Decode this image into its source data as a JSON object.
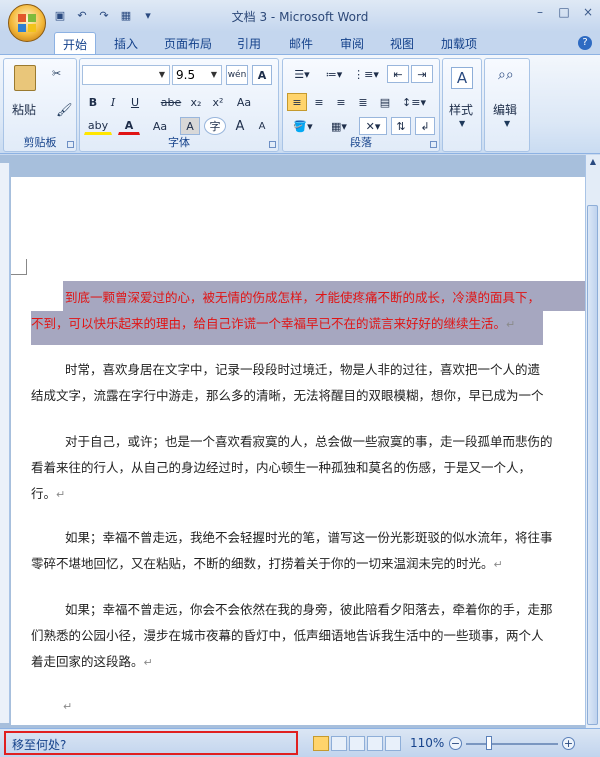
{
  "window": {
    "title": "文档 3 - Microsoft Word",
    "controls": {
      "minimize": "–",
      "maximize": "□",
      "close": "×"
    }
  },
  "quick_access": {
    "save_icon": "save-icon",
    "undo_icon": "undo-icon",
    "redo_icon": "redo-icon",
    "table_icon": "table-icon",
    "more_icon": "chevron-down-icon"
  },
  "tabs": [
    {
      "label": "开始",
      "active": true
    },
    {
      "label": "插入"
    },
    {
      "label": "页面布局"
    },
    {
      "label": "引用"
    },
    {
      "label": "邮件"
    },
    {
      "label": "审阅"
    },
    {
      "label": "视图"
    },
    {
      "label": "加载项"
    }
  ],
  "help": "?",
  "ribbon": {
    "clipboard": {
      "label": "剪贴板",
      "paste_label": "粘贴"
    },
    "font": {
      "label": "字体",
      "font_name": "",
      "font_size": "9.5",
      "wen_label": "wén",
      "A_box": "A",
      "bold": "B",
      "italic": "I",
      "underline": "U",
      "strike": "abe",
      "subscript": "x₂",
      "superscript": "x²",
      "clear_format": "Aa",
      "char_shade": "A",
      "enclose": "字",
      "grow": "A",
      "shrink": "A",
      "highlight": "aby",
      "font_color": "A",
      "change_case": "Aa"
    },
    "paragraph": {
      "label": "段落"
    },
    "styles": {
      "label": "样式"
    },
    "editing": {
      "label": "编辑"
    }
  },
  "document": {
    "paragraphs": [
      {
        "lines": [
          "到底一颗曾深爱过的心，被无情的伤成怎样，才能使疼痛不断的成长，冷漠的面具下，",
          "不到，可以快乐起来的理由，给自己诈谎一个幸福早已不在的谎言来好好的继续生活。"
        ],
        "selected": true
      },
      {
        "lines": [
          "时常，喜欢身居在文字中，记录一段段时过境迁，物是人非的过往，喜欢把一个人的遗",
          "结成文字，流露在字行中游走，那么多的清晰，无法将醒目的双眼模糊，想你，早已成为一个"
        ]
      },
      {
        "lines": [
          "对于自己，或许；也是一个喜欢看寂寞的人，总会做一些寂寞的事，走一段孤单而悲伤的",
          "看着来往的行人，从自己的身边经过时，内心顿生一种孤独和莫名的伤感，于是又一个人，",
          "行。"
        ]
      },
      {
        "lines": [
          "如果；幸福不曾走远，我绝不会轻握时光的笔，谱写这一份光影斑驳的似水流年，将往事",
          "零碎不堪地回忆，又在粘贴，不断的细数，打捞着关于你的一切来温润未完的时光。"
        ]
      },
      {
        "lines": [
          "如果；幸福不曾走远，你会不会依然在我的身旁，彼此陪看夕阳落去，牵着你的手，走那",
          "们熟悉的公园小径，漫步在城市夜幕的昏灯中，低声细语地告诉我生活中的一些琐事，两个人",
          "着走回家的这段路。"
        ]
      }
    ],
    "para_mark": "↵"
  },
  "status": {
    "text": "移至何处?",
    "zoom": "110%",
    "zoom_out": "−",
    "zoom_in": "+",
    "zoom_level": 1.1
  },
  "colors": {
    "ribbon_text": "#15428b",
    "selection": "#a6a7c0",
    "selected_text": "#e01414",
    "status_highlight_border": "#e02020"
  }
}
